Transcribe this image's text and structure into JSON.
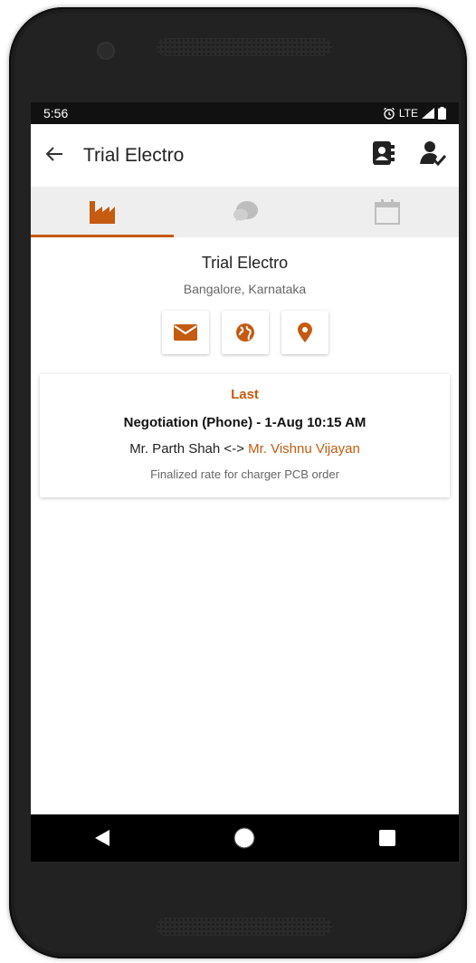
{
  "status_bar": {
    "time": "5:56",
    "network": "LTE",
    "icons": [
      "alarm-icon",
      "signal-icon",
      "battery-icon"
    ]
  },
  "app_bar": {
    "title": "Trial Electro",
    "back_icon": "arrow-left-icon",
    "actions": [
      "contact-book-icon",
      "user-check-icon"
    ]
  },
  "tabs": [
    {
      "icon": "factory-icon",
      "active": true
    },
    {
      "icon": "chat-bubbles-icon",
      "active": false
    },
    {
      "icon": "calendar-icon",
      "active": false
    }
  ],
  "company": {
    "name": "Trial Electro",
    "location": "Bangalore, Karnataka",
    "actions": [
      "email-icon",
      "globe-icon",
      "map-pin-icon"
    ]
  },
  "last_activity": {
    "heading": "Last",
    "title": "Negotiation (Phone) - 1-Aug 10:15 AM",
    "party_from": "Mr. Parth Shah",
    "separator": " <-> ",
    "party_to": "Mr. Vishnu Vijayan",
    "note": "Finalized rate for charger PCB order"
  },
  "colors": {
    "accent": "#c55a11",
    "tab_bg": "#eeeeee",
    "inactive_icon": "#bdbdbd"
  },
  "nav_bar": [
    "back-triangle-icon",
    "home-circle-icon",
    "recents-square-icon"
  ]
}
